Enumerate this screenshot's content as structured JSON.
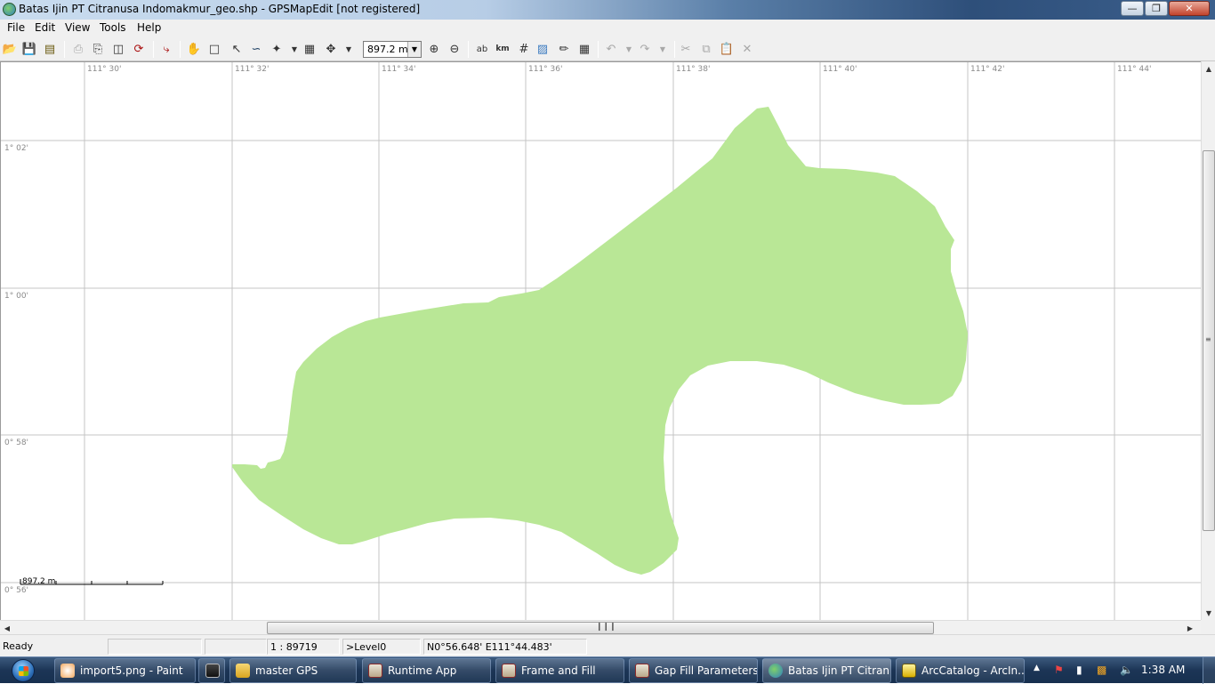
{
  "window": {
    "title": "Batas Ijin PT Citranusa Indomakmur_geo.shp - GPSMapEdit [not registered]",
    "min_icon": "minimize-icon",
    "max_icon": "maximize-icon",
    "close_icon": "close-icon"
  },
  "menu": [
    "File",
    "Edit",
    "View",
    "Tools",
    "Help"
  ],
  "toolbar": {
    "zoom_value": "897.2 m",
    "label_tool": "ab",
    "km_tool": "km"
  },
  "map": {
    "lon_labels": [
      "111° 30'",
      "111° 32'",
      "111° 34'",
      "111° 36'",
      "111° 38'",
      "111° 40'",
      "111° 42'",
      "111° 44'"
    ],
    "lat_labels": [
      "1° 02'",
      "1° 00'",
      "0° 58'",
      "0° 56'"
    ],
    "scale_label": "897.2 m",
    "polygon_fill": "#b9e796",
    "grid_color": "#c4c4c4"
  },
  "statusbar": {
    "ready": "Ready",
    "field2": "",
    "field3": "",
    "scale": "1 : 89719",
    "level": ">Level0",
    "coords": "N0°56.648' E111°44.483'"
  },
  "taskbar": {
    "items": [
      {
        "label": "import5.png - Paint"
      },
      {
        "label": ""
      },
      {
        "label": "master GPS"
      },
      {
        "label": "Runtime App"
      },
      {
        "label": "Frame and Fill"
      },
      {
        "label": "Gap Fill Parameters"
      },
      {
        "label": "Batas Ijin PT Citran..."
      },
      {
        "label": "ArcCatalog - ArcIn..."
      }
    ],
    "clock": "1:38 AM"
  }
}
